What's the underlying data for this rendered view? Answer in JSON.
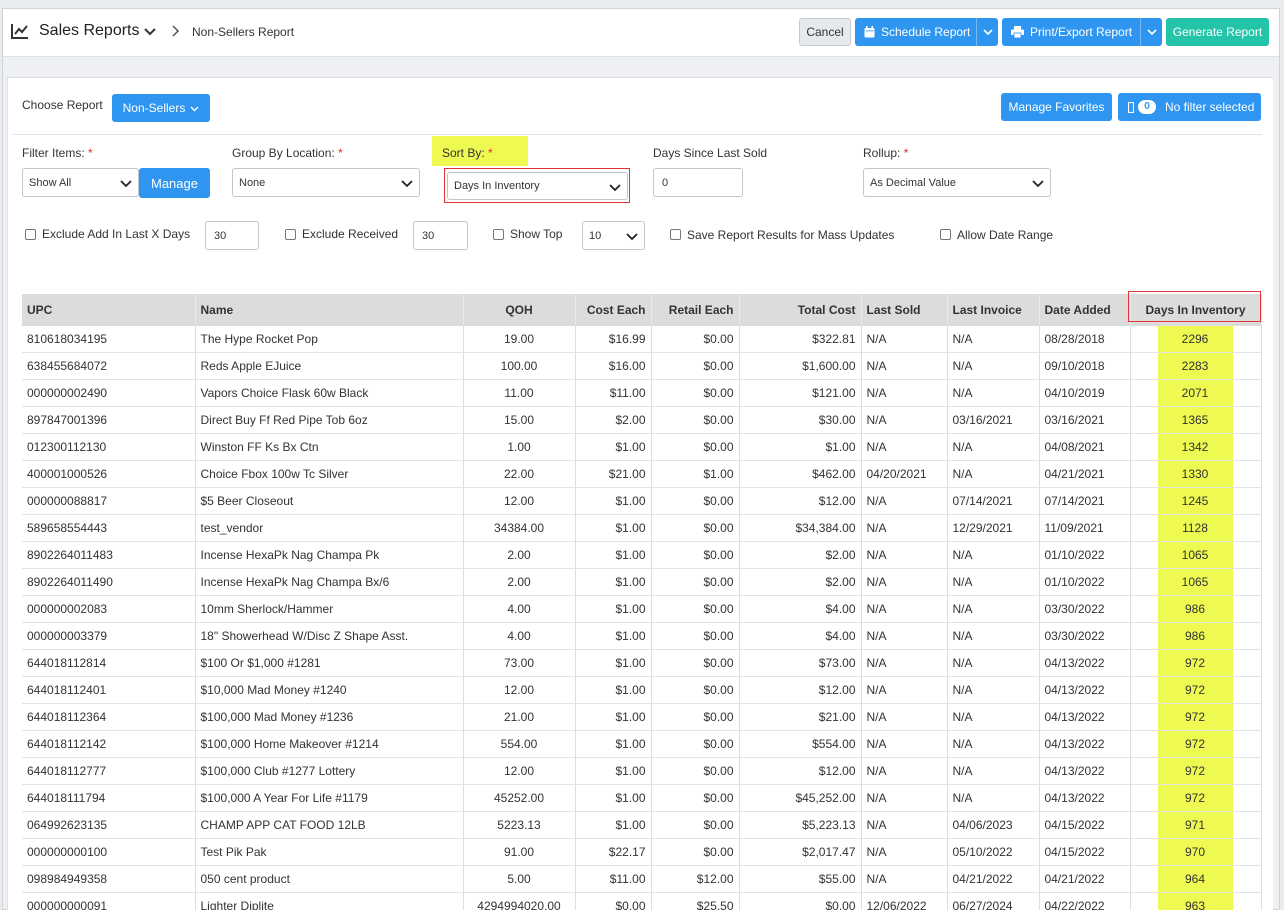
{
  "header": {
    "title": "Sales Reports",
    "breadcrumb": "Non-Sellers Report",
    "cancel_label": "Cancel",
    "schedule_label": "Schedule Report",
    "print_label": "Print/Export Report",
    "generate_label": "Generate Report"
  },
  "controls": {
    "choose_report_label": "Choose Report",
    "report_value": "Non-Sellers",
    "manage_favorites_label": "Manage Favorites",
    "filter_count": "0",
    "no_filter_label": "No filter selected",
    "filter_items_label": "Filter Items:",
    "filter_items_value": "Show All",
    "manage_label": "Manage",
    "group_by_label": "Group By Location:",
    "group_by_value": "None",
    "sort_by_label": "Sort By:",
    "sort_by_value": "Days In Inventory",
    "days_since_label": "Days Since Last Sold",
    "days_since_value": "0",
    "rollup_label": "Rollup:",
    "rollup_value": "As Decimal Value",
    "required_mark": "*",
    "exclude_add_label": "Exclude Add In Last X Days",
    "exclude_add_value": "30",
    "exclude_received_label": "Exclude Received",
    "exclude_received_value": "30",
    "show_top_label": "Show Top",
    "show_top_value": "10",
    "save_results_label": "Save Report Results for Mass Updates",
    "allow_date_label": "Allow Date Range"
  },
  "table": {
    "columns": [
      "UPC",
      "Name",
      "QOH",
      "Cost Each",
      "Retail Each",
      "Total Cost",
      "Last Sold",
      "Last Invoice",
      "Date Added",
      "Days In Inventory"
    ],
    "rows": [
      [
        "810618034195",
        "The Hype Rocket Pop",
        "19.00",
        "$16.99",
        "$0.00",
        "$322.81",
        "N/A",
        "N/A",
        "08/28/2018",
        "2296"
      ],
      [
        "638455684072",
        "Reds Apple EJuice",
        "100.00",
        "$16.00",
        "$0.00",
        "$1,600.00",
        "N/A",
        "N/A",
        "09/10/2018",
        "2283"
      ],
      [
        "000000002490",
        "Vapors Choice Flask 60w Black",
        "11.00",
        "$11.00",
        "$0.00",
        "$121.00",
        "N/A",
        "N/A",
        "04/10/2019",
        "2071"
      ],
      [
        "897847001396",
        "Direct Buy Ff Red Pipe Tob 6oz",
        "15.00",
        "$2.00",
        "$0.00",
        "$30.00",
        "N/A",
        "03/16/2021",
        "03/16/2021",
        "1365"
      ],
      [
        "012300112130",
        "Winston FF Ks Bx Ctn",
        "1.00",
        "$1.00",
        "$0.00",
        "$1.00",
        "N/A",
        "N/A",
        "04/08/2021",
        "1342"
      ],
      [
        "400001000526",
        "Choice Fbox 100w Tc Silver",
        "22.00",
        "$21.00",
        "$1.00",
        "$462.00",
        "04/20/2021",
        "N/A",
        "04/21/2021",
        "1330"
      ],
      [
        "000000088817",
        "$5 Beer Closeout",
        "12.00",
        "$1.00",
        "$0.00",
        "$12.00",
        "N/A",
        "07/14/2021",
        "07/14/2021",
        "1245"
      ],
      [
        "589658554443",
        "test_vendor",
        "34384.00",
        "$1.00",
        "$0.00",
        "$34,384.00",
        "N/A",
        "12/29/2021",
        "11/09/2021",
        "1128"
      ],
      [
        "8902264011483",
        "Incense HexaPk Nag Champa Pk",
        "2.00",
        "$1.00",
        "$0.00",
        "$2.00",
        "N/A",
        "N/A",
        "01/10/2022",
        "1065"
      ],
      [
        "8902264011490",
        "Incense HexaPk Nag Champa Bx/6",
        "2.00",
        "$1.00",
        "$0.00",
        "$2.00",
        "N/A",
        "N/A",
        "01/10/2022",
        "1065"
      ],
      [
        "000000002083",
        "10mm Sherlock/Hammer",
        "4.00",
        "$1.00",
        "$0.00",
        "$4.00",
        "N/A",
        "N/A",
        "03/30/2022",
        "986"
      ],
      [
        "000000003379",
        "18\" Showerhead W/Disc Z Shape Asst.",
        "4.00",
        "$1.00",
        "$0.00",
        "$4.00",
        "N/A",
        "N/A",
        "03/30/2022",
        "986"
      ],
      [
        "644018112814",
        "$100 Or $1,000 #1281",
        "73.00",
        "$1.00",
        "$0.00",
        "$73.00",
        "N/A",
        "N/A",
        "04/13/2022",
        "972"
      ],
      [
        "644018112401",
        "$10,000 Mad Money #1240",
        "12.00",
        "$1.00",
        "$0.00",
        "$12.00",
        "N/A",
        "N/A",
        "04/13/2022",
        "972"
      ],
      [
        "644018112364",
        "$100,000 Mad Money #1236",
        "21.00",
        "$1.00",
        "$0.00",
        "$21.00",
        "N/A",
        "N/A",
        "04/13/2022",
        "972"
      ],
      [
        "644018112142",
        "$100,000 Home Makeover #1214",
        "554.00",
        "$1.00",
        "$0.00",
        "$554.00",
        "N/A",
        "N/A",
        "04/13/2022",
        "972"
      ],
      [
        "644018112777",
        "$100,000 Club #1277 Lottery",
        "12.00",
        "$1.00",
        "$0.00",
        "$12.00",
        "N/A",
        "N/A",
        "04/13/2022",
        "972"
      ],
      [
        "644018111794",
        "$100,000 A Year For Life #1179",
        "45252.00",
        "$1.00",
        "$0.00",
        "$45,252.00",
        "N/A",
        "N/A",
        "04/13/2022",
        "972"
      ],
      [
        "064992623135",
        "CHAMP APP CAT FOOD 12LB",
        "5223.13",
        "$1.00",
        "$0.00",
        "$5,223.13",
        "N/A",
        "04/06/2023",
        "04/15/2022",
        "971"
      ],
      [
        "000000000100",
        "Test Pik Pak",
        "91.00",
        "$22.17",
        "$0.00",
        "$2,017.47",
        "N/A",
        "05/10/2022",
        "04/15/2022",
        "970"
      ],
      [
        "098984949358",
        "050 cent product",
        "5.00",
        "$11.00",
        "$12.00",
        "$55.00",
        "N/A",
        "04/21/2022",
        "04/21/2022",
        "964"
      ],
      [
        "000000000091",
        "Lighter Diplite",
        "4294994020.00",
        "$0.00",
        "$25.50",
        "$0.00",
        "12/06/2022",
        "06/27/2024",
        "04/22/2022",
        "963"
      ]
    ]
  }
}
